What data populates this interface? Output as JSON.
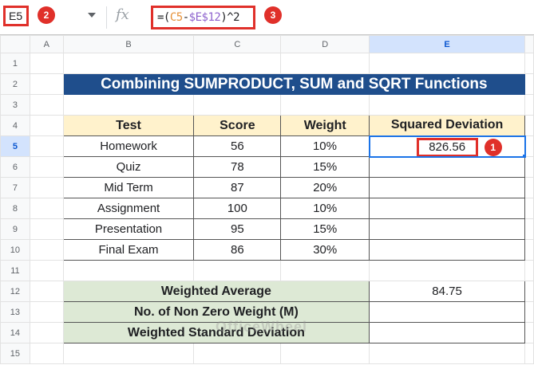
{
  "formula_bar": {
    "name_box": "E5",
    "fx": "fx",
    "formula_prefix": "=(",
    "formula_ref1": "C5",
    "formula_mid": "-",
    "formula_ref2": "$E$12",
    "formula_suffix": ")^2"
  },
  "badges": [
    "1",
    "2",
    "3"
  ],
  "columns": [
    "A",
    "B",
    "C",
    "D",
    "E"
  ],
  "rows": [
    "1",
    "2",
    "3",
    "4",
    "5",
    "6",
    "7",
    "8",
    "9",
    "10",
    "11",
    "12",
    "13",
    "14",
    "15"
  ],
  "title": "Combining SUMPRODUCT, SUM and SQRT Functions",
  "table": {
    "headers": [
      "Test",
      "Score",
      "Weight",
      "Squared Deviation"
    ],
    "rows": [
      {
        "test": "Homework",
        "score": "56",
        "weight": "10%",
        "sqdev": "826.56"
      },
      {
        "test": "Quiz",
        "score": "78",
        "weight": "15%",
        "sqdev": ""
      },
      {
        "test": "Mid Term",
        "score": "87",
        "weight": "20%",
        "sqdev": ""
      },
      {
        "test": "Assignment",
        "score": "100",
        "weight": "10%",
        "sqdev": ""
      },
      {
        "test": "Presentation",
        "score": "95",
        "weight": "15%",
        "sqdev": ""
      },
      {
        "test": "Final Exam",
        "score": "86",
        "weight": "30%",
        "sqdev": ""
      }
    ]
  },
  "summary": [
    {
      "label": "Weighted Average",
      "value": "84.75"
    },
    {
      "label": "No. of Non Zero Weight (M)",
      "value": ""
    },
    {
      "label": "Weighted Standard Deviation",
      "value": ""
    }
  ],
  "watermark": "OfficeWheel"
}
